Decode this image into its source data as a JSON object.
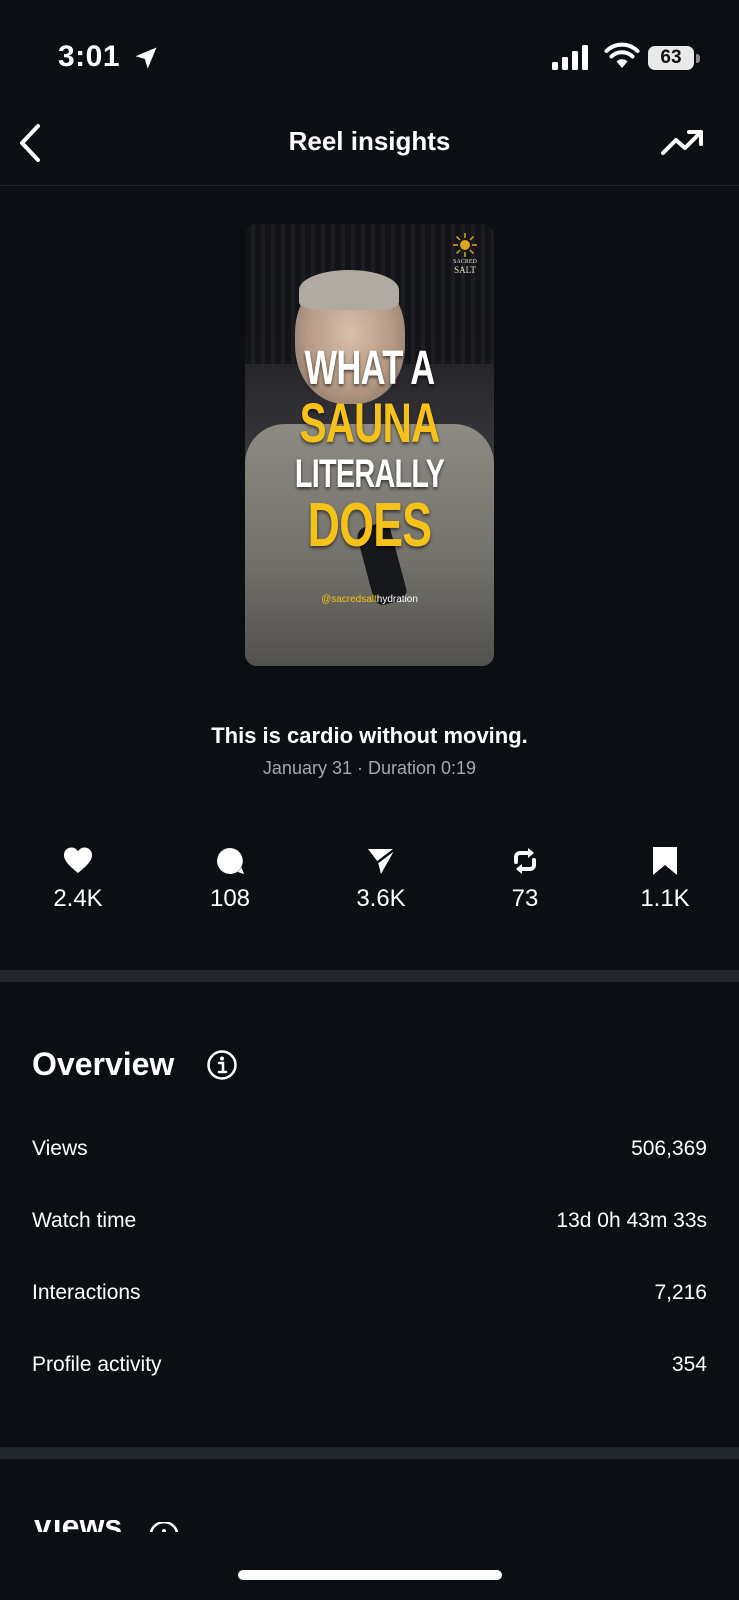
{
  "status_bar": {
    "time": "3:01",
    "battery": "63"
  },
  "header": {
    "title": "Reel insights"
  },
  "reel": {
    "thumbnail": {
      "text_line1": "WHAT A",
      "text_line2": "SAUNA",
      "text_line3": "LITERALLY",
      "text_line4": "DOES",
      "handle_highlight": "@sacredsalt",
      "handle_rest": "hydration",
      "brand_line1": "SACRED",
      "brand_line2": "SALT"
    },
    "caption": "This is cardio without moving.",
    "meta": "January 31 · Duration 0:19"
  },
  "stats": [
    {
      "icon": "heart-icon",
      "value": "2.4K"
    },
    {
      "icon": "comment-icon",
      "value": "108"
    },
    {
      "icon": "share-icon",
      "value": "3.6K"
    },
    {
      "icon": "repost-icon",
      "value": "73"
    },
    {
      "icon": "save-icon",
      "value": "1.1K"
    }
  ],
  "overview": {
    "title": "Overview",
    "rows": [
      {
        "label": "Views",
        "value": "506,369"
      },
      {
        "label": "Watch time",
        "value": "13d 0h 43m 33s"
      },
      {
        "label": "Interactions",
        "value": "7,216"
      },
      {
        "label": "Profile activity",
        "value": "354"
      }
    ]
  },
  "next_section": {
    "title": "Views"
  },
  "colors": {
    "background": "#0b0f14",
    "text": "#ffffff",
    "muted": "#a3a8ae",
    "divider": "#22272d",
    "accent_yellow": "#f6c21a"
  }
}
